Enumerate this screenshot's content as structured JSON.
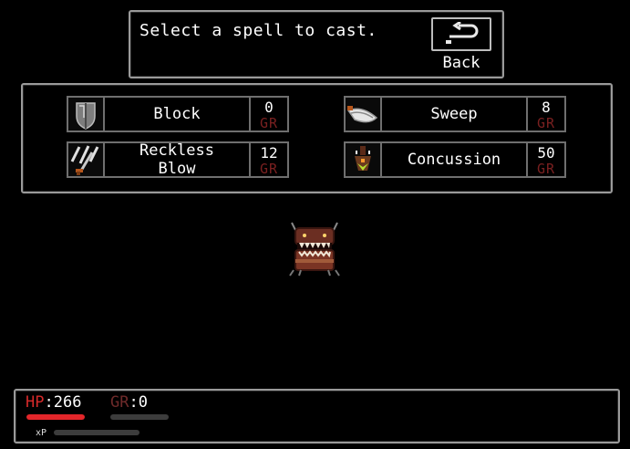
{
  "prompt": {
    "text": "Select a spell to cast.",
    "back_label": "Back",
    "back_icon": "return-arrow-icon"
  },
  "spells": [
    {
      "name": "Block",
      "cost": "0",
      "unit": "GR",
      "icon": "shield-icon"
    },
    {
      "name": "Sweep",
      "cost": "8",
      "unit": "GR",
      "icon": "sweep-blade-icon"
    },
    {
      "name": "Reckless\nBlow",
      "cost": "12",
      "unit": "GR",
      "icon": "slashing-sword-icon"
    },
    {
      "name": "Concussion",
      "cost": "50",
      "unit": "GR",
      "icon": "concussion-blast-icon"
    }
  ],
  "enemy": {
    "icon": "mimic-chest-icon"
  },
  "status": {
    "hp_label": "HP",
    "hp_value": ":266",
    "gr_label": "GR",
    "gr_value": ":0",
    "xp_label": "xP",
    "hp_fraction": 1.0,
    "gr_fraction": 0.0,
    "xp_fraction": 0.0
  },
  "colors": {
    "hp_red": "#e3262a",
    "gr_dark_red": "#7a2020",
    "panel_border": "#9a9a9a",
    "background": "#000000"
  }
}
